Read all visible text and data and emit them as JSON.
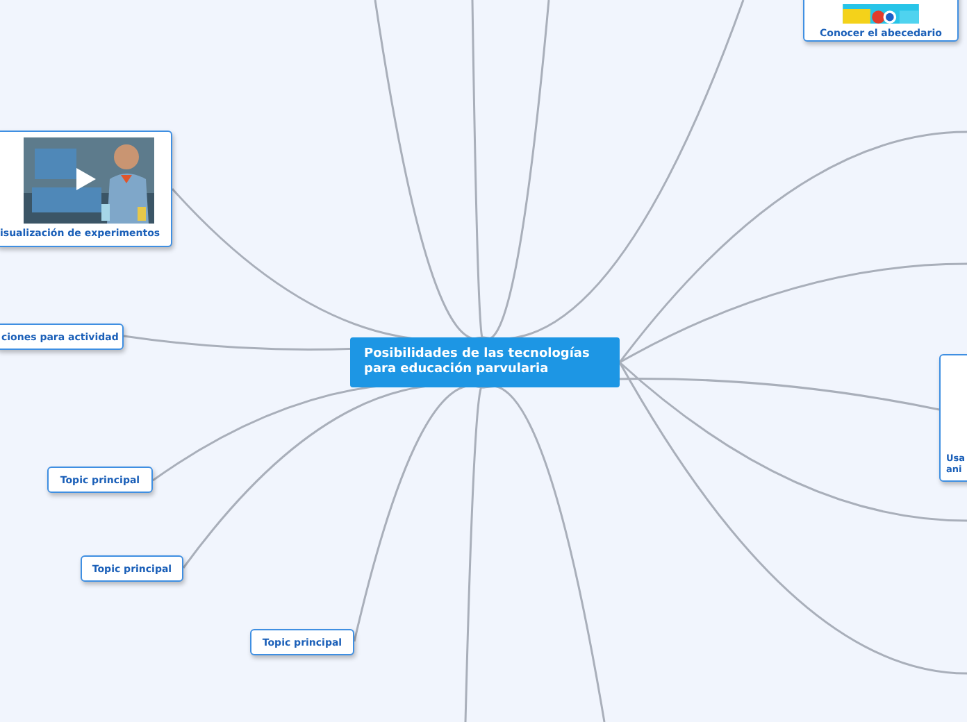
{
  "central_topic": "Posibilidades de las tecnologías para educación parvularia",
  "topics": [
    {
      "label": "isualización de experimentos"
    },
    {
      "label": "Conocer el abecedario"
    },
    {
      "kind": "text",
      "label": "ciones para actividad"
    },
    {
      "kind": "text",
      "label": "Topic principal"
    },
    {
      "kind": "text",
      "label": "Topic principal"
    },
    {
      "kind": "text",
      "label": "Topic principal"
    },
    {
      "kind": "partial",
      "lines": [
        "Usa",
        "ani"
      ]
    }
  ]
}
